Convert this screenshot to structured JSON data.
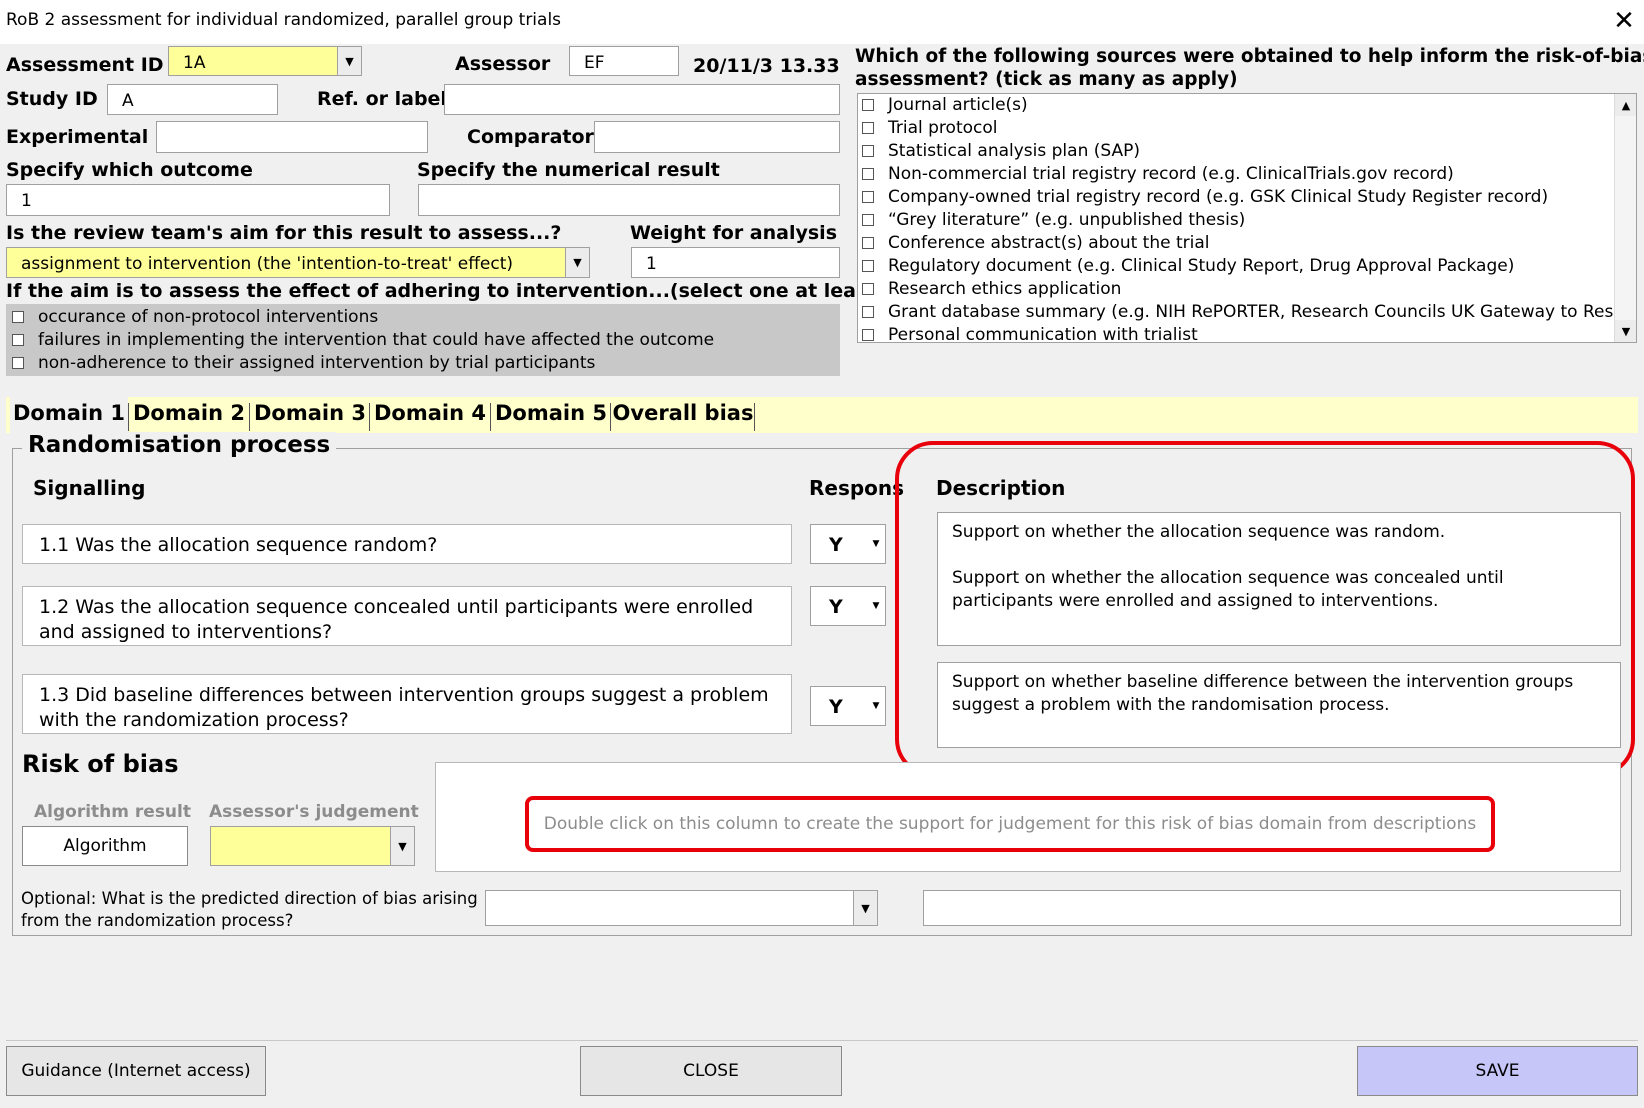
{
  "window": {
    "title": "RoB 2 assessment for individual randomized, parallel group trials",
    "close_glyph": "✕"
  },
  "header": {
    "assessment_id_label": "Assessment ID",
    "assessment_id_value": "1A",
    "assessor_label": "Assessor",
    "assessor_value": "EF",
    "timestamp": "20/11/3 13.33",
    "study_id_label": "Study ID",
    "study_id_value": "A",
    "ref_label": "Ref. or label",
    "ref_value": "",
    "experimental_label": "Experimental",
    "experimental_value": "",
    "comparator_label": "Comparator",
    "comparator_value": "",
    "outcome_label": "Specify which outcome",
    "outcome_value": "1",
    "numerical_label": "Specify the numerical result",
    "numerical_value": "",
    "aim_label": "Is the review team's aim for this result to assess...?",
    "aim_value": "assignment to intervention (the 'intention-to-treat' effect)",
    "weight_label": "Weight for analysis",
    "weight_value": "1",
    "adhering_label": "If the aim is to assess the effect of adhering to intervention...(select one at least)",
    "adhering_options": [
      "occurance of non-protocol interventions",
      "failures in implementing the intervention that could have affected the outcome",
      "non-adherence to their assigned intervention by trial participants"
    ]
  },
  "sources": {
    "label_line1": "Which of the following sources were obtained to help inform the risk-of-bias",
    "label_line2": "assessment? (tick as many as apply)",
    "items": [
      "Journal article(s)",
      "Trial protocol",
      "Statistical analysis plan (SAP)",
      "Non-commercial trial registry record (e.g. ClinicalTrials.gov record)",
      "Company-owned trial registry record (e.g. GSK Clinical Study Register record)",
      "“Grey literature” (e.g. unpublished thesis)",
      "Conference abstract(s) about the trial",
      "Regulatory document (e.g. Clinical Study Report, Drug Approval Package)",
      "Research ethics application",
      "Grant database summary (e.g. NIH RePORTER, Research Councils UK Gateway to Resea",
      "Personal communication with trialist"
    ]
  },
  "tabs": [
    "Domain 1",
    "Domain 2",
    "Domain 3",
    "Domain 4",
    "Domain 5",
    "Overall bias"
  ],
  "domain": {
    "title": "Randomisation process",
    "signalling_label": "Signalling",
    "response_label": "Respons",
    "description_label": "Description",
    "questions": [
      {
        "text": "1.1 Was the allocation sequence random?",
        "response": "Y"
      },
      {
        "text": "1.2 Was the allocation sequence concealed until participants were enrolled and assigned to interventions?",
        "response": "Y"
      },
      {
        "text": "1.3 Did baseline differences between intervention groups suggest a problem with the randomization process?",
        "response": "Y"
      }
    ],
    "descriptions": [
      "Support on whether the allocation sequence was random.\n\nSupport on whether the allocation sequence was concealed until participants were enrolled and assigned to interventions.",
      "Support on whether baseline difference between the intervention groups suggest a problem with the randomisation process."
    ],
    "risk_title": "Risk of bias",
    "algorithm_result_label": "Algorithm result",
    "assessor_judgement_label": "Assessor's judgement",
    "algorithm_button": "Algorithm",
    "judgement_value": "",
    "support_hint": "Double click on this column to create the support for judgement for this risk of bias domain from descriptions",
    "direction_label_line1": "Optional: What is the predicted direction of bias arising",
    "direction_label_line2": "from the randomization process?",
    "direction_value": "",
    "direction_note": ""
  },
  "footer": {
    "guidance_button": "Guidance (Internet access)",
    "close_button": "CLOSE",
    "save_button": "SAVE"
  },
  "colors": {
    "highlight_yellow": "#ffff99",
    "tab_strip": "#ffffcc",
    "annotation_red": "#e8000b",
    "save_button": "#c6c6f8"
  }
}
